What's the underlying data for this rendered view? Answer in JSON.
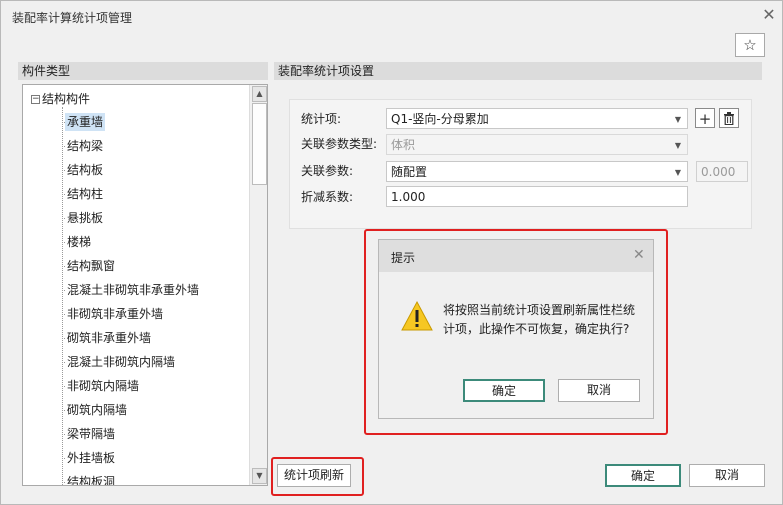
{
  "window": {
    "title": "装配率计算统计项管理"
  },
  "left": {
    "header": "构件类型",
    "root": "结构构件",
    "items": [
      "承重墙",
      "结构梁",
      "结构板",
      "结构柱",
      "悬挑板",
      "楼梯",
      "结构飘窗",
      "混凝土非砌筑非承重外墙",
      "非砌筑非承重外墙",
      "砌筑非承重外墙",
      "混凝土非砌筑内隔墙",
      "非砌筑内隔墙",
      "砌筑内隔墙",
      "梁带隔墙",
      "外挂墙板",
      "结构板洞"
    ]
  },
  "right": {
    "header": "装配率统计项设置"
  },
  "form": {
    "stat_label": "统计项:",
    "stat_value": "Q1-竖向-分母累加",
    "param_type_label": "关联参数类型:",
    "param_type_value": "体积",
    "param_label": "关联参数:",
    "param_value": "随配置",
    "param_extra": "0.000",
    "factor_label": "折减系数:",
    "factor_value": "1.000"
  },
  "dialog": {
    "title": "提示",
    "message": "将按照当前统计项设置刷新属性栏统计项，此操作不可恢复，确定执行?",
    "ok": "确定",
    "cancel": "取消"
  },
  "bottom": {
    "refresh": "统计项刷新",
    "ok": "确定",
    "cancel": "取消"
  },
  "icons": {
    "close": "close-icon",
    "star": "star-icon",
    "add": "plus-icon",
    "delete": "trash-icon",
    "warning": "warning-icon"
  },
  "colors": {
    "highlight": "#e02020",
    "primary_border": "#3c8a7a",
    "selected": "#cfe3f5"
  }
}
